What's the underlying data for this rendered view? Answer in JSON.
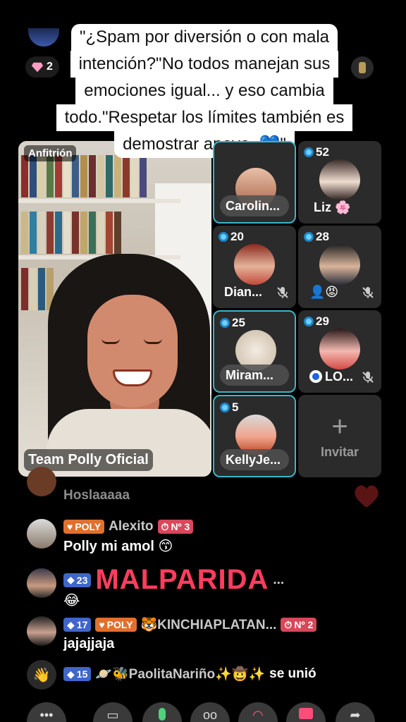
{
  "caption": {
    "lines": [
      "\"¿Spam por diversión o con mala",
      "intención?\"No todos manejan sus",
      "emociones igual... y eso cambia",
      "todo.\"Respetar los límites también es",
      "demostrar apoyo. 💙\""
    ]
  },
  "top": {
    "gem_count": "2"
  },
  "host": {
    "role": "Anfitrión",
    "name": "Team Polly Oficial"
  },
  "guests": [
    {
      "name": "Carolin...",
      "score": "",
      "muted": false
    },
    {
      "name": "Liz 🌸",
      "score": "52",
      "muted": false
    },
    {
      "name": "Dian...",
      "score": "20",
      "muted": true
    },
    {
      "name": "👤😡",
      "score": "28",
      "muted": true
    },
    {
      "name": "Miram...",
      "score": "25",
      "muted": false
    },
    {
      "name": "LO...",
      "score": "29",
      "muted": true
    },
    {
      "name": "KellyJe...",
      "score": "5",
      "muted": false
    }
  ],
  "invite": {
    "label": "Invitar"
  },
  "chat": [
    {
      "user": "",
      "text": "Hoslaaaaa"
    },
    {
      "fan_badge": "POLY",
      "user": "Alexito",
      "rank": "Nº 3",
      "text": "Polly mi amol 😙"
    },
    {
      "level": "23",
      "overlay": "MALPARIDA",
      "suffix": "...",
      "text": "😂"
    },
    {
      "level": "17",
      "fan_badge": "POLY",
      "user": "🐯KINCHIAPLATAN...",
      "rank": "Nº 2",
      "text": "jajajjaja"
    },
    {
      "level": "15",
      "user": "🪐🐝PaolitaNariño✨🤠✨",
      "joined": "se unió"
    }
  ],
  "colors": {
    "accent": "#3ab6c8",
    "highlight": "#ff3d5e",
    "fan_badge": "#e0702e",
    "level_badge": "#3f66c9"
  }
}
